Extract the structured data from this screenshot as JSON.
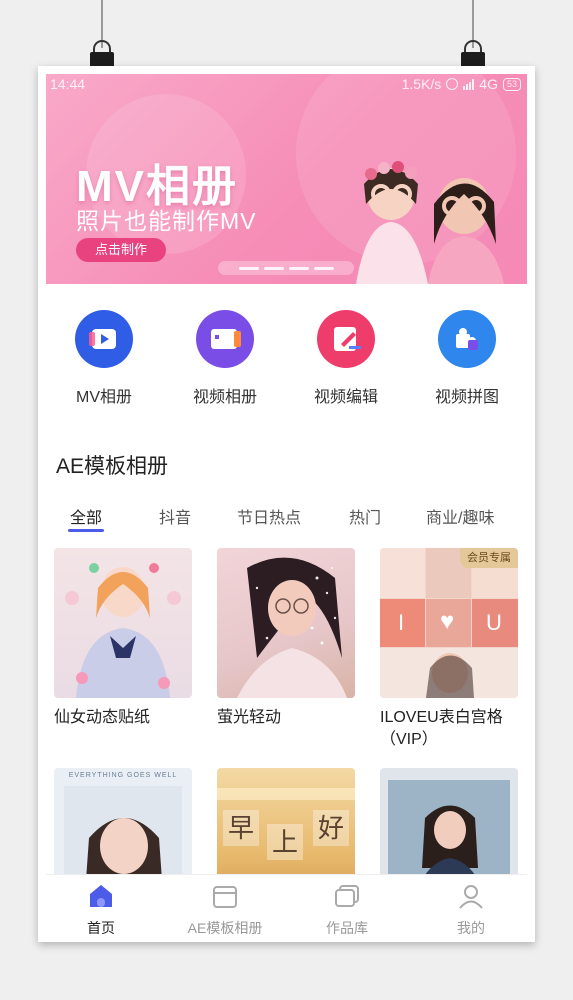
{
  "status_bar": {
    "time": "14:44",
    "speed": "1.5K/s",
    "network": "4G",
    "battery": "53"
  },
  "banner": {
    "title": "MV相册",
    "subtitle": "照片也能制作MV",
    "button": "点击制作"
  },
  "quick_actions": [
    {
      "label": "MV相册",
      "icon": "mv-album-icon",
      "color": "#2f5de6"
    },
    {
      "label": "视频相册",
      "icon": "video-album-icon",
      "color": "#7a4ee6"
    },
    {
      "label": "视频编辑",
      "icon": "video-edit-icon",
      "color": "#ef3d6b"
    },
    {
      "label": "视频拼图",
      "icon": "video-puzzle-icon",
      "color": "#2f86ec"
    }
  ],
  "section": {
    "title": "AE模板相册",
    "tabs": [
      "全部",
      "抖音",
      "节日热点",
      "热门",
      "商业/趣味"
    ],
    "active_tab": "全部"
  },
  "cards": [
    {
      "title": "仙女动态贴纸"
    },
    {
      "title": "萤光轻动"
    },
    {
      "title": "ILOVEU表白宫格（VIP）",
      "badge": "会员专属",
      "grid_letters": [
        "I",
        "♥",
        "U"
      ]
    },
    {
      "title": "",
      "overlay_text": "EVERYTHING GOES WELL"
    },
    {
      "title": "",
      "overlay_chars": [
        "早",
        "上",
        "好"
      ]
    },
    {
      "title": ""
    }
  ],
  "bottom_nav": [
    {
      "label": "首页",
      "icon": "home-icon",
      "active": true
    },
    {
      "label": "AE模板相册",
      "icon": "template-box-icon",
      "active": false
    },
    {
      "label": "作品库",
      "icon": "library-icon",
      "active": false
    },
    {
      "label": "我的",
      "icon": "profile-icon",
      "active": false
    }
  ]
}
